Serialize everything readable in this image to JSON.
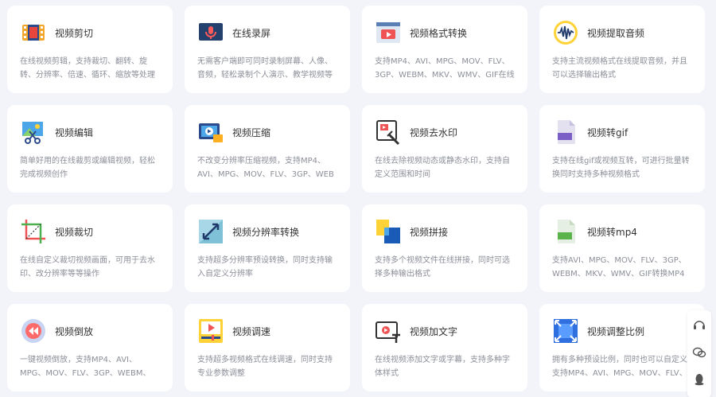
{
  "tools": [
    {
      "icon": "film-strip-icon",
      "title": "视频剪切",
      "desc": "在线视频剪辑，支持裁切、翻转、旋转、分辨率、倍速、循环、缩放等处理"
    },
    {
      "icon": "microphone-screen-icon",
      "title": "在线录屏",
      "desc": "无需客户端即可同时录制屏幕、人像、音频，轻松录制个人演示、教学视频等"
    },
    {
      "icon": "video-window-icon",
      "title": "视频格式转换",
      "desc": "支持MP4、AVI、MPG、MOV、FLV、3GP、WEBM、MKV、WMV、GIF在线"
    },
    {
      "icon": "waveform-icon",
      "title": "视频提取音频",
      "desc": "支持主流视频格式在线提取音频，并且可以选择输出格式"
    },
    {
      "icon": "video-scissors-icon",
      "title": "视频编辑",
      "desc": "简单好用的在线裁剪或编辑视频，轻松完成视频创作"
    },
    {
      "icon": "video-compress-icon",
      "title": "视频压缩",
      "desc": "不改变分辨率压缩视频，支持MP4、AVI、MPG、MOV、FLV、3GP、WEB"
    },
    {
      "icon": "watermark-remove-icon",
      "title": "视频去水印",
      "desc": "在线去除视频动态或静态水印，支持自定义范围和时间"
    },
    {
      "icon": "gif-file-icon",
      "title": "视频转gif",
      "desc": "支持在线gif或视频互转，可进行批量转换同时支持多种视频格式"
    },
    {
      "icon": "crop-icon",
      "title": "视频裁切",
      "desc": "在线自定义裁切视频画面，可用于去水印、改分辨率等等操作"
    },
    {
      "icon": "resolution-arrows-icon",
      "title": "视频分辨率转换",
      "desc": "支持超多分辨率预设转换，同时支持输入自定义分辨率"
    },
    {
      "icon": "merge-blocks-icon",
      "title": "视频拼接",
      "desc": "支持多个视频文件在线拼接，同时可选择多种输出格式"
    },
    {
      "icon": "mp4-file-icon",
      "title": "视频转mp4",
      "desc": "支持AVI、MPG、MOV、FLV、3GP、WEBM、MKV、WMV、GIF转换MP4"
    },
    {
      "icon": "rewind-icon",
      "title": "视频倒放",
      "desc": "一键视频倒放，支持MP4、AVI、MPG、MOV、FLV、3GP、WEBM、MK"
    },
    {
      "icon": "speed-adjust-icon",
      "title": "视频调速",
      "desc": "支持超多视频格式在线调速，同时支持专业参数调整"
    },
    {
      "icon": "video-text-icon",
      "title": "视频加文字",
      "desc": "在线视频添加文字或字幕，支持多种字体样式"
    },
    {
      "icon": "aspect-ratio-icon",
      "title": "视频调整比例",
      "desc": "拥有多种预设比例，同时也可以自定义支持MP4、AVI、MPG、MOV、FLV、3"
    }
  ],
  "side": [
    {
      "icon": "headset-icon"
    },
    {
      "icon": "wechat-icon"
    },
    {
      "icon": "qq-icon"
    }
  ]
}
